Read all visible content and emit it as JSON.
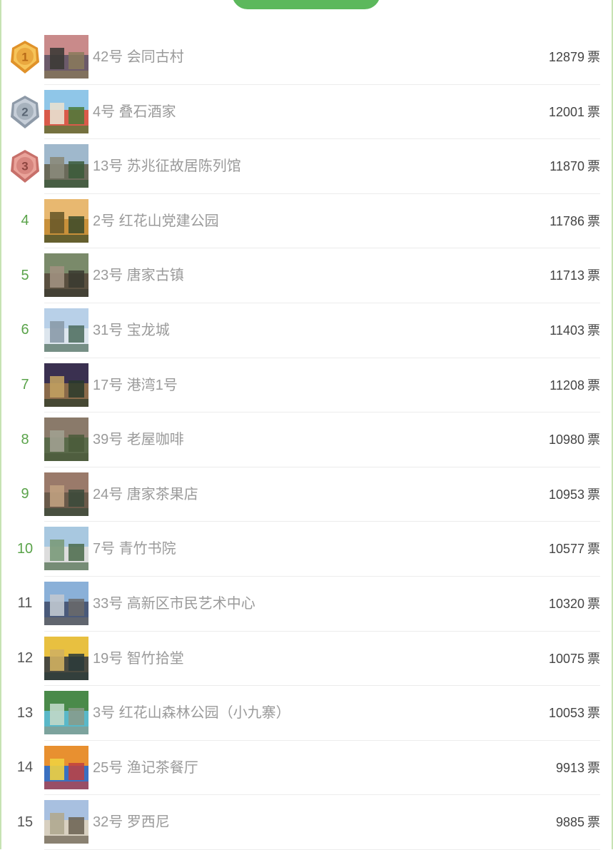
{
  "colors": {
    "accent": "#5cb85c",
    "rank_green": "#5aa34a",
    "gold": "#e8a83a",
    "silver": "#8e9aa8",
    "bronze": "#c7706a"
  },
  "vote_unit": "票",
  "items": [
    {
      "rank": "1",
      "medal": "gold",
      "name": "42号 会同古村",
      "votes": "12879",
      "thumb_icon": "ancient-village-photo"
    },
    {
      "rank": "2",
      "medal": "silver",
      "name": "4号 叠石酒家",
      "votes": "12001",
      "thumb_icon": "restaurant-photo"
    },
    {
      "rank": "3",
      "medal": "bronze",
      "name": "13号 苏兆征故居陈列馆",
      "votes": "11870",
      "thumb_icon": "museum-photo"
    },
    {
      "rank": "4",
      "medal": "",
      "name": "2号 红花山党建公园",
      "votes": "11786",
      "thumb_icon": "park-photo"
    },
    {
      "rank": "5",
      "medal": "",
      "name": "23号 唐家古镇",
      "votes": "11713",
      "thumb_icon": "old-town-photo"
    },
    {
      "rank": "6",
      "medal": "",
      "name": "31号 宝龙城",
      "votes": "11403",
      "thumb_icon": "city-photo"
    },
    {
      "rank": "7",
      "medal": "",
      "name": "17号 港湾1号",
      "votes": "11208",
      "thumb_icon": "night-harbor-photo"
    },
    {
      "rank": "8",
      "medal": "",
      "name": "39号 老屋咖啡",
      "votes": "10980",
      "thumb_icon": "coffee-house-photo"
    },
    {
      "rank": "9",
      "medal": "",
      "name": "24号 唐家茶果店",
      "votes": "10953",
      "thumb_icon": "tea-shop-photo"
    },
    {
      "rank": "10",
      "medal": "",
      "name": "7号 青竹书院",
      "votes": "10577",
      "thumb_icon": "academy-photo"
    },
    {
      "rank": "11",
      "medal": "",
      "name": "33号 高新区市民艺术中心",
      "votes": "10320",
      "thumb_icon": "art-center-photo"
    },
    {
      "rank": "12",
      "medal": "",
      "name": "19号 智竹拾堂",
      "votes": "10075",
      "thumb_icon": "hall-photo"
    },
    {
      "rank": "13",
      "medal": "",
      "name": "3号 红花山森林公园（小九寨）",
      "votes": "10053",
      "thumb_icon": "forest-lake-photo"
    },
    {
      "rank": "14",
      "medal": "",
      "name": "25号 渔记茶餐厅",
      "votes": "9913",
      "thumb_icon": "graffiti-photo"
    },
    {
      "rank": "15",
      "medal": "",
      "name": "32号 罗西尼",
      "votes": "9885",
      "thumb_icon": "hotel-photo"
    }
  ]
}
